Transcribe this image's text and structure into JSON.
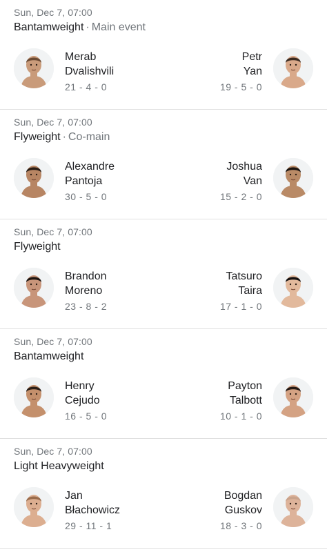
{
  "fights": [
    {
      "date": "Sun, Dec 7, 07:00",
      "weight_class": "Bantamweight",
      "tag": "Main event",
      "left": {
        "first": "Merab",
        "last": "Dvalishvili",
        "record": "21 - 4 - 0",
        "skin": "#c99b7a",
        "hair": "#6b4a33"
      },
      "right": {
        "first": "Petr",
        "last": "Yan",
        "record": "19 - 5 - 0",
        "skin": "#d9a98a",
        "hair": "#3a2a20"
      }
    },
    {
      "date": "Sun, Dec 7, 07:00",
      "weight_class": "Flyweight",
      "tag": "Co-main",
      "left": {
        "first": "Alexandre",
        "last": "Pantoja",
        "record": "30 - 5 - 0",
        "skin": "#b78563",
        "hair": "#2a1d15"
      },
      "right": {
        "first": "Joshua",
        "last": "Van",
        "record": "15 - 2 - 0",
        "skin": "#b98a66",
        "hair": "#1a1410"
      }
    },
    {
      "date": "Sun, Dec 7, 07:00",
      "weight_class": "Flyweight",
      "tag": "",
      "left": {
        "first": "Brandon",
        "last": "Moreno",
        "record": "23 - 8 - 2",
        "skin": "#c8957a",
        "hair": "#1e1612"
      },
      "right": {
        "first": "Tatsuro",
        "last": "Taira",
        "record": "17 - 1 - 0",
        "skin": "#e2b99c",
        "hair": "#141010"
      }
    },
    {
      "date": "Sun, Dec 7, 07:00",
      "weight_class": "Bantamweight",
      "tag": "",
      "left": {
        "first": "Henry",
        "last": "Cejudo",
        "record": "16 - 5 - 0",
        "skin": "#c4906c",
        "hair": "#2b1f18"
      },
      "right": {
        "first": "Payton",
        "last": "Talbott",
        "record": "10 - 1 - 0",
        "skin": "#d4a283",
        "hair": "#241914"
      }
    },
    {
      "date": "Sun, Dec 7, 07:00",
      "weight_class": "Light Heavyweight",
      "tag": "",
      "left": {
        "first": "Jan",
        "last": "Błachowicz",
        "record": "29 - 11 - 1",
        "skin": "#dcae90",
        "hair": "#9a6c4c"
      },
      "right": {
        "first": "Bogdan",
        "last": "Guskov",
        "record": "18 - 3 - 0",
        "skin": "#ddb39a",
        "hair": "#c9a38c"
      }
    }
  ]
}
